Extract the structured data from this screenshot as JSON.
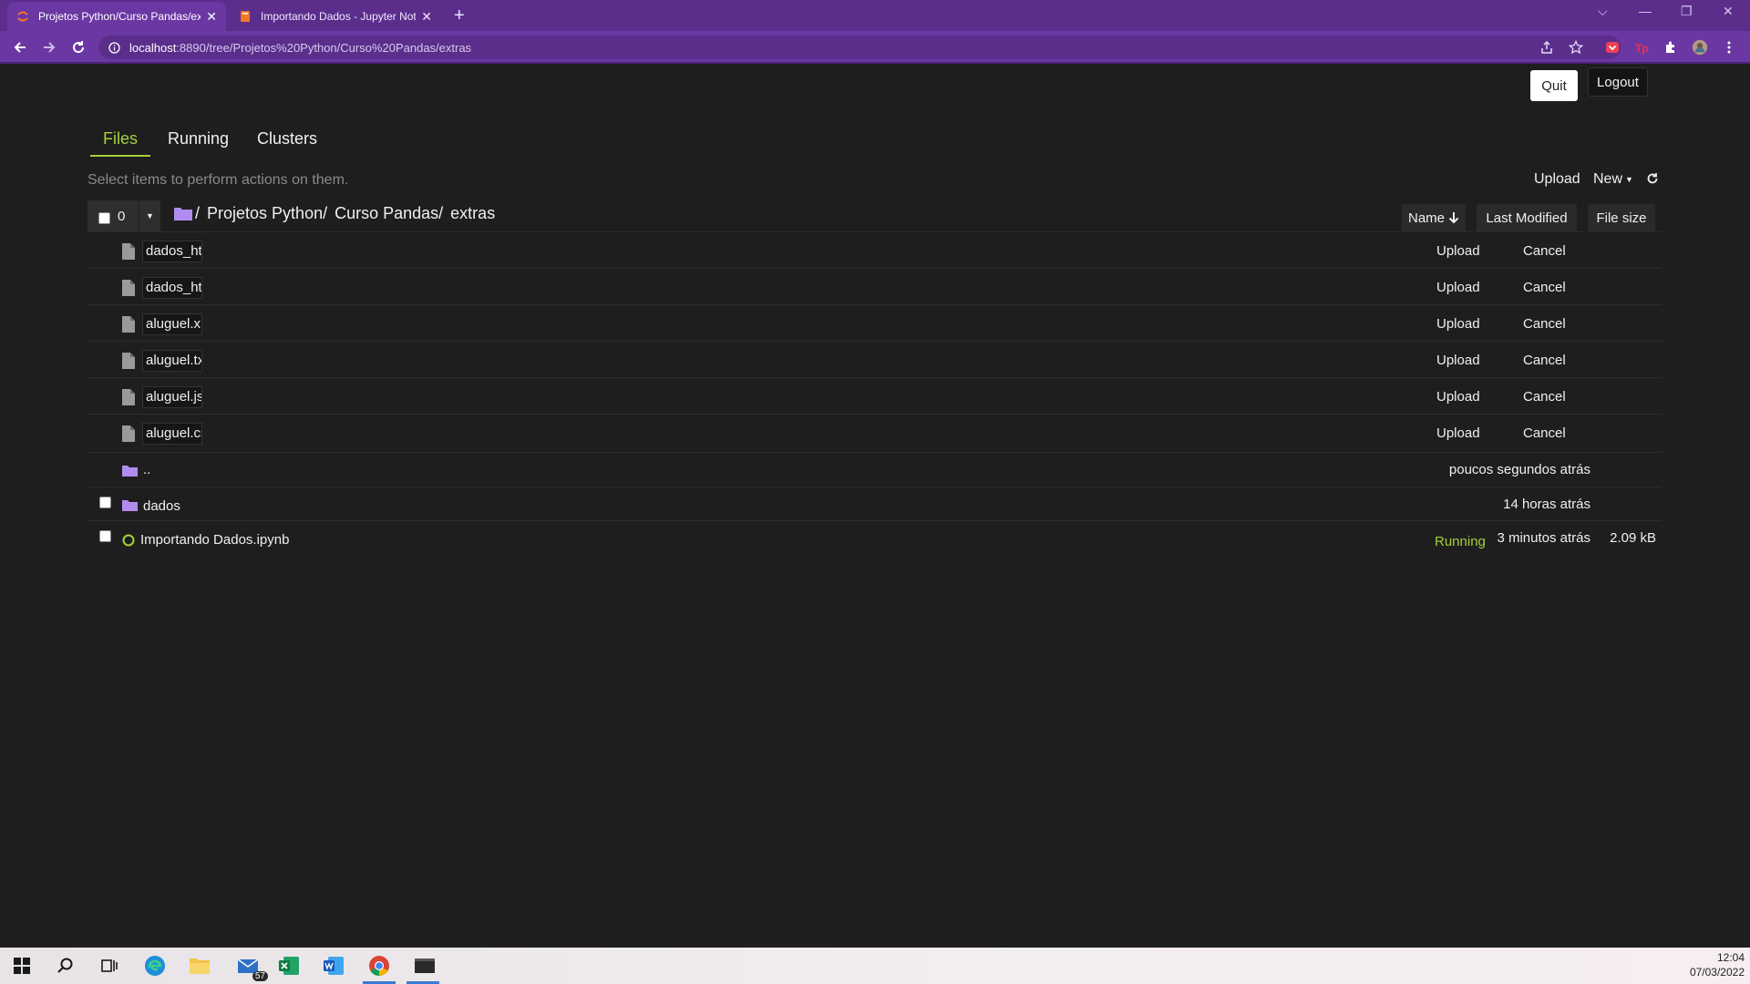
{
  "browser": {
    "tabs": [
      {
        "title": "Projetos Python/Curso Pandas/extras/",
        "active": true
      },
      {
        "title": "Importando Dados - Jupyter Notebook",
        "active": false
      }
    ],
    "url_host": "localhost",
    "url_path": ":8890/tree/Projetos%20Python/Curso%20Pandas/extras"
  },
  "header": {
    "quit_label": "Quit",
    "logout_label": "Logout"
  },
  "tabs": {
    "files": "Files",
    "running": "Running",
    "clusters": "Clusters"
  },
  "toolbar": {
    "hint": "Select items to perform actions on them.",
    "upload": "Upload",
    "new": "New",
    "selected_count": "0"
  },
  "breadcrumb": [
    "/",
    "Projetos Python/",
    "Curso Pandas/",
    "extras"
  ],
  "sort": {
    "name": "Name",
    "last_modified": "Last Modified",
    "file_size": "File size"
  },
  "pending_uploads": [
    {
      "name": "dados_html",
      "upload": "Upload",
      "cancel": "Cancel"
    },
    {
      "name": "dados_html",
      "upload": "Upload",
      "cancel": "Cancel"
    },
    {
      "name": "aluguel.xlsx",
      "upload": "Upload",
      "cancel": "Cancel"
    },
    {
      "name": "aluguel.txt",
      "upload": "Upload",
      "cancel": "Cancel"
    },
    {
      "name": "aluguel.json",
      "upload": "Upload",
      "cancel": "Cancel"
    },
    {
      "name": "aluguel.csv",
      "upload": "Upload",
      "cancel": "Cancel"
    }
  ],
  "items": [
    {
      "name": "..",
      "modified": "poucos segundos atrás"
    },
    {
      "name": "dados",
      "modified": "14 horas atrás"
    },
    {
      "name": "Importando Dados.ipynb",
      "status": "Running",
      "modified": "3 minutos atrás",
      "size": "2.09 kB"
    }
  ],
  "taskbar": {
    "mail_badge": "57",
    "time": "12:04",
    "date": "07/03/2022"
  },
  "colors": {
    "accent": "#a4d13a",
    "browser": "#6b37a3",
    "folder": "#b08cf0"
  }
}
